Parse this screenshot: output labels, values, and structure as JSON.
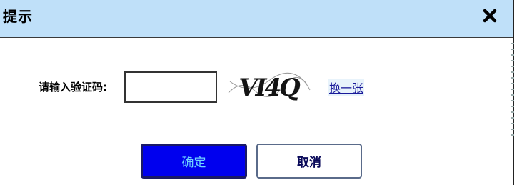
{
  "dialog": {
    "title": "提示",
    "close_icon": "close-icon"
  },
  "form": {
    "label": "请输入验证码:",
    "input_value": "",
    "captcha_text": "VI4Q",
    "refresh_label": "换一张"
  },
  "buttons": {
    "ok_label": "确定",
    "cancel_label": "取消"
  },
  "colors": {
    "titlebar": "#bfe0f9",
    "ok_button": "#0000ee",
    "ok_text": "#6fd3ff",
    "link": "#1a1a9a"
  }
}
